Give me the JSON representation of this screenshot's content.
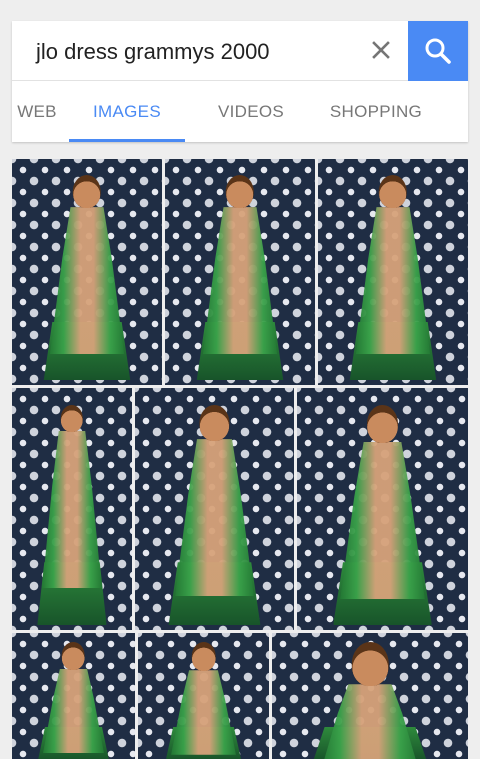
{
  "search": {
    "query": "jlo dress grammys 2000"
  },
  "icons": {
    "clear": "close-icon",
    "search": "search-icon"
  },
  "colors": {
    "accent": "#4a8af4",
    "background": "#eeeeee",
    "tile_bg": "#1f2d44"
  },
  "tabs": [
    {
      "label": "WEB",
      "active": false
    },
    {
      "label": "IMAGES",
      "active": true
    },
    {
      "label": "VIDEOS",
      "active": false
    },
    {
      "label": "SHOPPING",
      "active": false
    }
  ],
  "results": [
    {
      "name": "image-result-1"
    },
    {
      "name": "image-result-2"
    },
    {
      "name": "image-result-3"
    },
    {
      "name": "image-result-4"
    },
    {
      "name": "image-result-5"
    },
    {
      "name": "image-result-6"
    },
    {
      "name": "image-result-7"
    },
    {
      "name": "image-result-8"
    },
    {
      "name": "image-result-9"
    }
  ]
}
